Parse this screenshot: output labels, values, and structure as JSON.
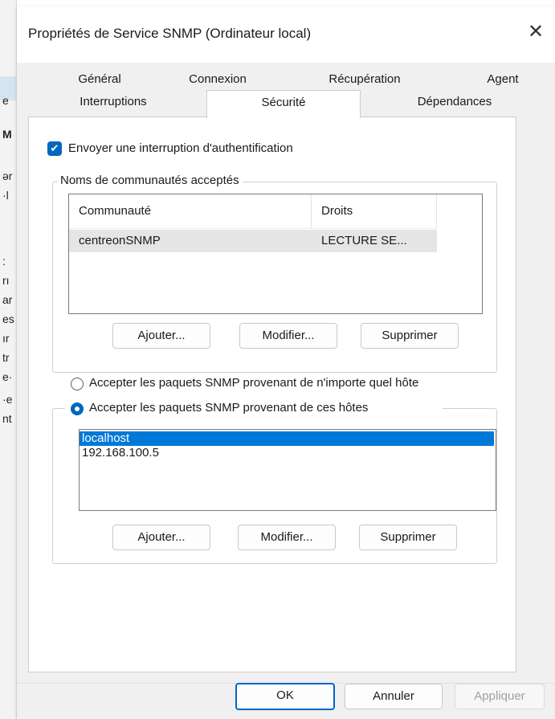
{
  "background_window": {
    "fragments": [
      "e",
      "M",
      "ər",
      "·l",
      ":",
      "rı",
      "ar",
      "es",
      "ır",
      "tr",
      "e·",
      "·e",
      "nt"
    ]
  },
  "dialog": {
    "title": "Propriétés de Service SNMP (Ordinateur local)",
    "close_glyph": "✕"
  },
  "tabs": {
    "row1": [
      "Général",
      "Connexion",
      "Récupération",
      "Agent"
    ],
    "row2": [
      "Interruptions",
      "Sécurité",
      "Dépendances"
    ],
    "active": "Sécurité"
  },
  "security": {
    "auth_trap": {
      "label": "Envoyer une interruption d'authentification",
      "checked": true,
      "check_glyph": "✔"
    },
    "communities": {
      "group_title": "Noms de communautés acceptés",
      "columns": [
        "Communauté",
        "Droits"
      ],
      "rows": [
        {
          "community": "centreonSNMP",
          "rights": "LECTURE SE..."
        }
      ],
      "buttons": {
        "add": "Ajouter...",
        "edit": "Modifier...",
        "remove": "Supprimer"
      }
    },
    "hosts": {
      "radio_any": "Accepter les paquets SNMP provenant de n'importe quel hôte",
      "radio_these": "Accepter les paquets SNMP provenant de ces hôtes",
      "selected_option": "these",
      "list": [
        "localhost",
        "192.168.100.5"
      ],
      "selected_item": "localhost",
      "buttons": {
        "add": "Ajouter...",
        "edit": "Modifier...",
        "remove": "Supprimer"
      }
    }
  },
  "footer": {
    "ok": "OK",
    "cancel": "Annuler",
    "apply": "Appliquer"
  },
  "colors": {
    "accent": "#0067c0",
    "selection": "#0078d7",
    "dialog_bg": "#f0f0f0"
  }
}
